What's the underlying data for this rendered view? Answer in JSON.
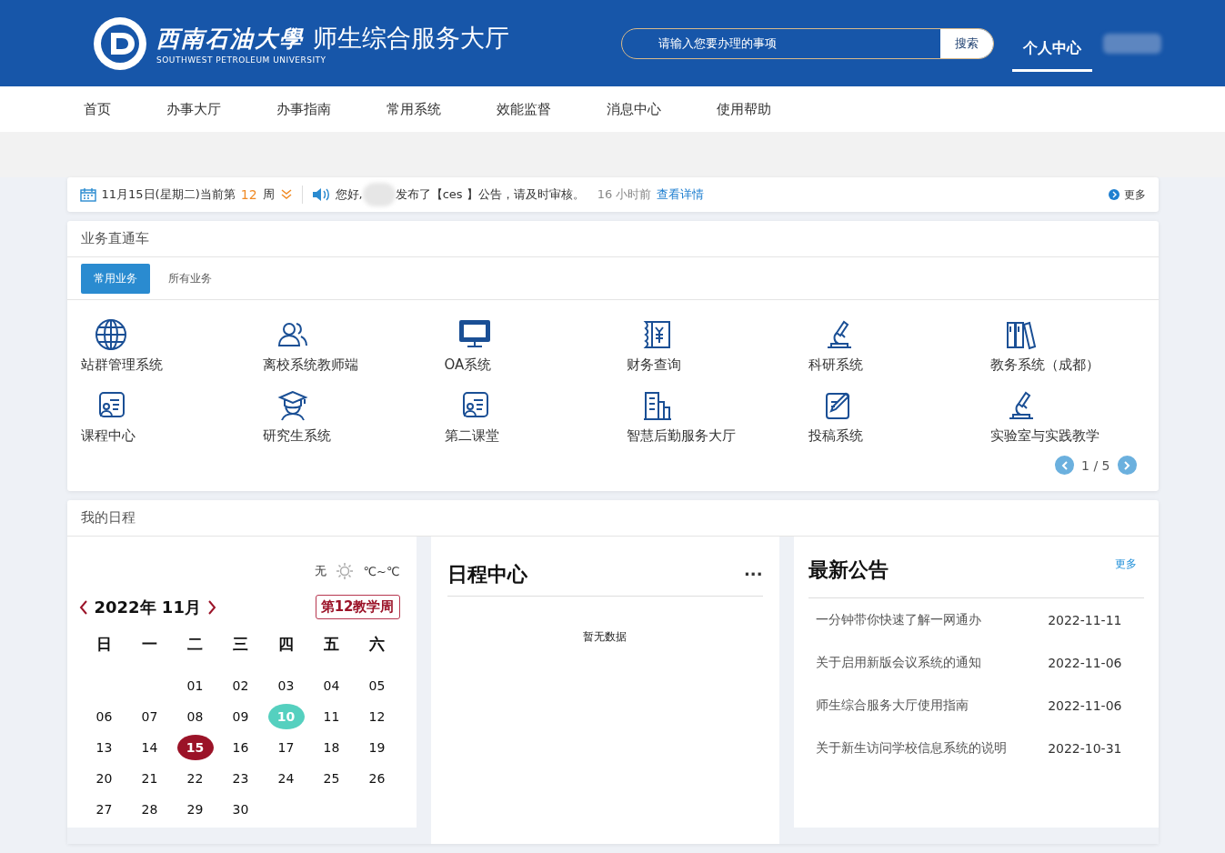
{
  "header": {
    "university_name": "西南石油大學",
    "portal_title": "师生综合服务大厅",
    "university_english": "SOUTHWEST PETROLEUM UNIVERSITY",
    "search": {
      "placeholder": "请输入您要办理的事项",
      "button": "搜索"
    },
    "user_menu": [
      {
        "label": "个人中心",
        "selected": true
      }
    ]
  },
  "nav": [
    {
      "label": "首页"
    },
    {
      "label": "办事大厅"
    },
    {
      "label": "办事指南"
    },
    {
      "label": "常用系统"
    },
    {
      "label": "效能监督"
    },
    {
      "label": "消息中心"
    },
    {
      "label": "使用帮助"
    }
  ],
  "notice_bar": {
    "date_text": "11月15日(星期二)当前第",
    "week": "12",
    "week_unit": "周",
    "greeting": "您好,",
    "message": "发布了【ces 】公告，请及时审核。",
    "time": "16 小时前",
    "detail_link": "查看详情",
    "more": "更多"
  },
  "services": {
    "title": "业务直通车",
    "tabs": [
      {
        "label": "常用业务",
        "selected": true
      },
      {
        "label": "所有业务",
        "selected": false
      }
    ],
    "items": [
      {
        "label": "站群管理系统"
      },
      {
        "label": "离校系统教师端"
      },
      {
        "label": "OA系统"
      },
      {
        "label": "财务查询"
      },
      {
        "label": "科研系统"
      },
      {
        "label": "教务系统（成都）"
      },
      {
        "label": "课程中心"
      },
      {
        "label": "研究生系统"
      },
      {
        "label": "第二课堂"
      },
      {
        "label": "智慧后勤服务大厅"
      },
      {
        "label": "投稿系统"
      },
      {
        "label": "实验室与实践教学"
      }
    ],
    "pager": "1 / 5"
  },
  "schedule": {
    "title": "我的日程",
    "calendar": {
      "weather": "无",
      "temperature": "℃~℃",
      "month": "2022年 11月",
      "teaching_week": "第12教学周",
      "weekdays": [
        "日",
        "一",
        "二",
        "三",
        "四",
        "五",
        "六"
      ],
      "weeks": [
        {
          "kind": "leading_gap",
          "days": [
            {
              "day": "01",
              "kind": "normal"
            },
            {
              "day": "02",
              "kind": "normal"
            },
            {
              "day": "03",
              "kind": "normal"
            },
            {
              "day": "04",
              "kind": "normal"
            },
            {
              "day": "05",
              "kind": "normal"
            }
          ]
        },
        {
          "kind": "full",
          "days": [
            {
              "day": "06",
              "kind": "normal"
            },
            {
              "day": "07",
              "kind": "normal"
            },
            {
              "day": "08",
              "kind": "normal"
            },
            {
              "day": "09",
              "kind": "normal"
            },
            {
              "day": "10",
              "kind": "event"
            },
            {
              "day": "11",
              "kind": "normal"
            },
            {
              "day": "12",
              "kind": "normal"
            }
          ]
        },
        {
          "kind": "full",
          "days": [
            {
              "day": "13",
              "kind": "normal"
            },
            {
              "day": "14",
              "kind": "normal"
            },
            {
              "day": "15",
              "kind": "today"
            },
            {
              "day": "16",
              "kind": "normal"
            },
            {
              "day": "17",
              "kind": "normal"
            },
            {
              "day": "18",
              "kind": "normal"
            },
            {
              "day": "19",
              "kind": "normal"
            }
          ]
        },
        {
          "kind": "full",
          "days": [
            {
              "day": "20",
              "kind": "normal"
            },
            {
              "day": "21",
              "kind": "normal"
            },
            {
              "day": "22",
              "kind": "normal"
            },
            {
              "day": "23",
              "kind": "normal"
            },
            {
              "day": "24",
              "kind": "normal"
            },
            {
              "day": "25",
              "kind": "normal"
            },
            {
              "day": "26",
              "kind": "normal"
            }
          ]
        },
        {
          "kind": "full",
          "days": [
            {
              "day": "27",
              "kind": "normal"
            },
            {
              "day": "28",
              "kind": "normal"
            },
            {
              "day": "29",
              "kind": "normal"
            },
            {
              "day": "30",
              "kind": "normal"
            }
          ]
        }
      ]
    },
    "agenda": {
      "title": "日程中心",
      "menu": "···",
      "empty": "暂无数据"
    },
    "announcements": {
      "title": "最新公告",
      "more": "更多",
      "items": [
        {
          "title": "一分钟带你快速了解一网通办",
          "date": "2022-11-11"
        },
        {
          "title": "关于启用新版会议系统的通知",
          "date": "2022-11-06"
        },
        {
          "title": "师生综合服务大厅使用指南",
          "date": "2022-11-06"
        },
        {
          "title": "关于新生访问学校信息系统的说明",
          "date": "2022-10-31"
        }
      ]
    }
  }
}
